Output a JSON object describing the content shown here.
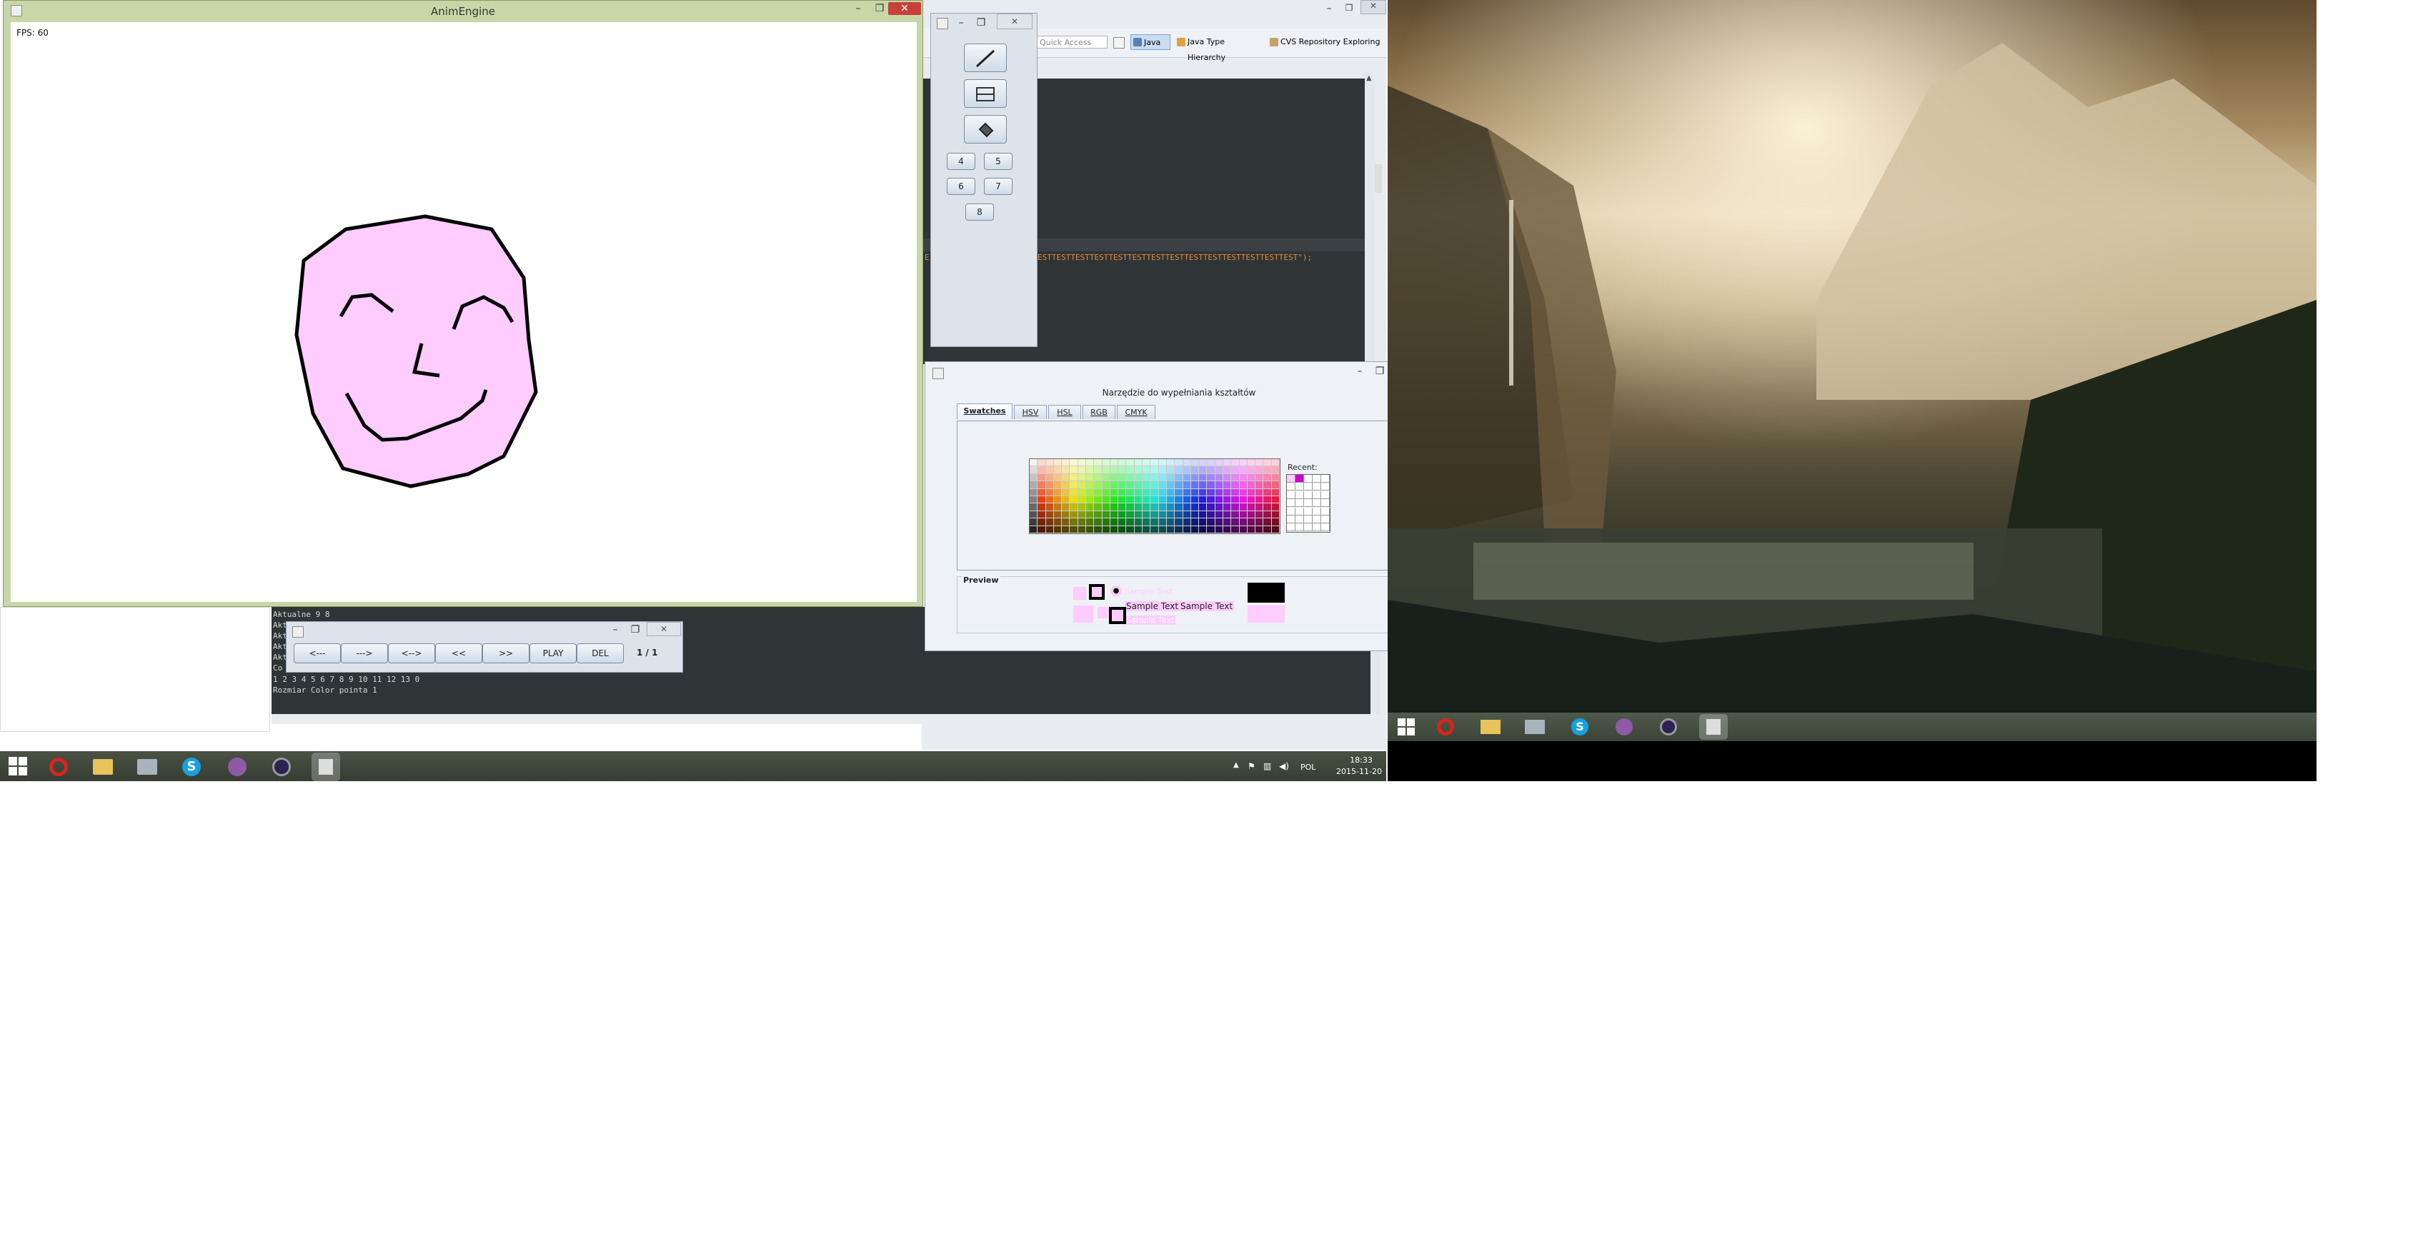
{
  "anim_window": {
    "title": "AnimEngine",
    "fps": "FPS: 60",
    "face_fill": "#ffccff"
  },
  "tool_window": {
    "numbers": [
      "4",
      "5",
      "6",
      "7",
      "8"
    ]
  },
  "eclipse": {
    "quick_access": "Quick Access",
    "perspectives": [
      "Java",
      "Java Type Hierarchy",
      "CVS Repository Exploring"
    ],
    "code_line": "ESTTESTTESTTESTTESTTESTTESTTESTTESTTESTTESTTESTTESTTEST\");",
    "code_prefix": "E"
  },
  "console": {
    "lines_top": [
      "Aktualne 9 8",
      "Akt",
      "Akt",
      "Akt",
      "Akt",
      "Co"
    ],
    "lines_bottom": [
      "1 2 3 4 5 6 7 8 9 10 11 12 13 0",
      "Rozmiar Color pointa 1"
    ]
  },
  "player": {
    "buttons": [
      "<---",
      "--->",
      "<-->",
      "<<",
      ">>",
      "PLAY",
      "DEL"
    ],
    "page": "1 / 1"
  },
  "color_chooser": {
    "title": "Narzędzie do wypełniania kształtów",
    "tabs": [
      "Swatches",
      "HSV",
      "HSL",
      "RGB",
      "CMYK"
    ],
    "recent_label": "Recent:",
    "preview_label": "Preview",
    "sample_text": "Sample Text",
    "selected_color": "#ffccff"
  },
  "taskbar": {
    "language": "POL",
    "time": "18:33",
    "date": "2015-11-20"
  }
}
